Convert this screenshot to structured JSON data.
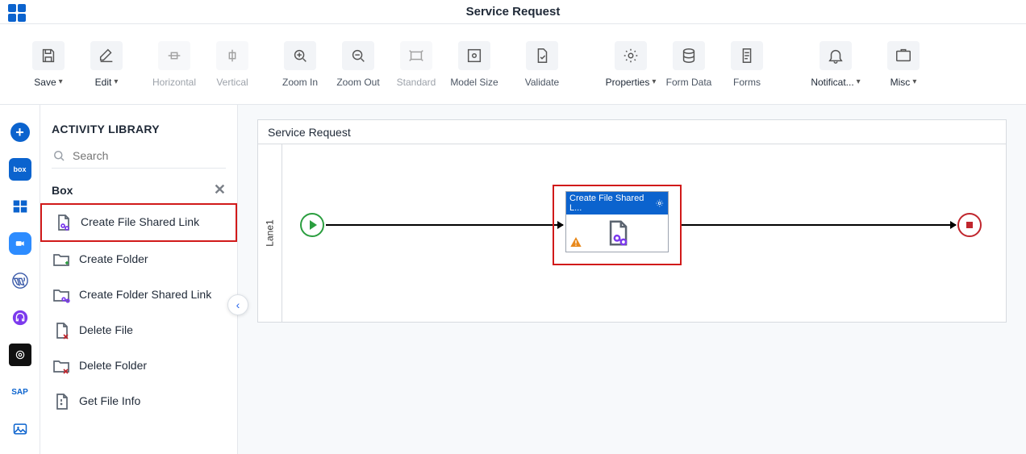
{
  "header": {
    "page_title": "Service Request"
  },
  "toolbar": {
    "save": "Save",
    "edit": "Edit",
    "horizontal": "Horizontal",
    "vertical": "Vertical",
    "zoom_in": "Zoom In",
    "zoom_out": "Zoom Out",
    "standard": "Standard",
    "model_size": "Model Size",
    "validate": "Validate",
    "properties": "Properties",
    "form_data": "Form Data",
    "forms": "Forms",
    "notifications": "Notificat...",
    "misc": "Misc"
  },
  "panel": {
    "title": "ACTIVITY LIBRARY",
    "search_placeholder": "Search",
    "category": "Box"
  },
  "activities": {
    "a0": "Create File Shared Link",
    "a1": "Create Folder",
    "a2": "Create Folder Shared Link",
    "a3": "Delete File",
    "a4": "Delete Folder",
    "a5": "Get File Info"
  },
  "canvas": {
    "title": "Service Request",
    "lane": "Lane1",
    "node_label": "Create File Shared L..."
  }
}
